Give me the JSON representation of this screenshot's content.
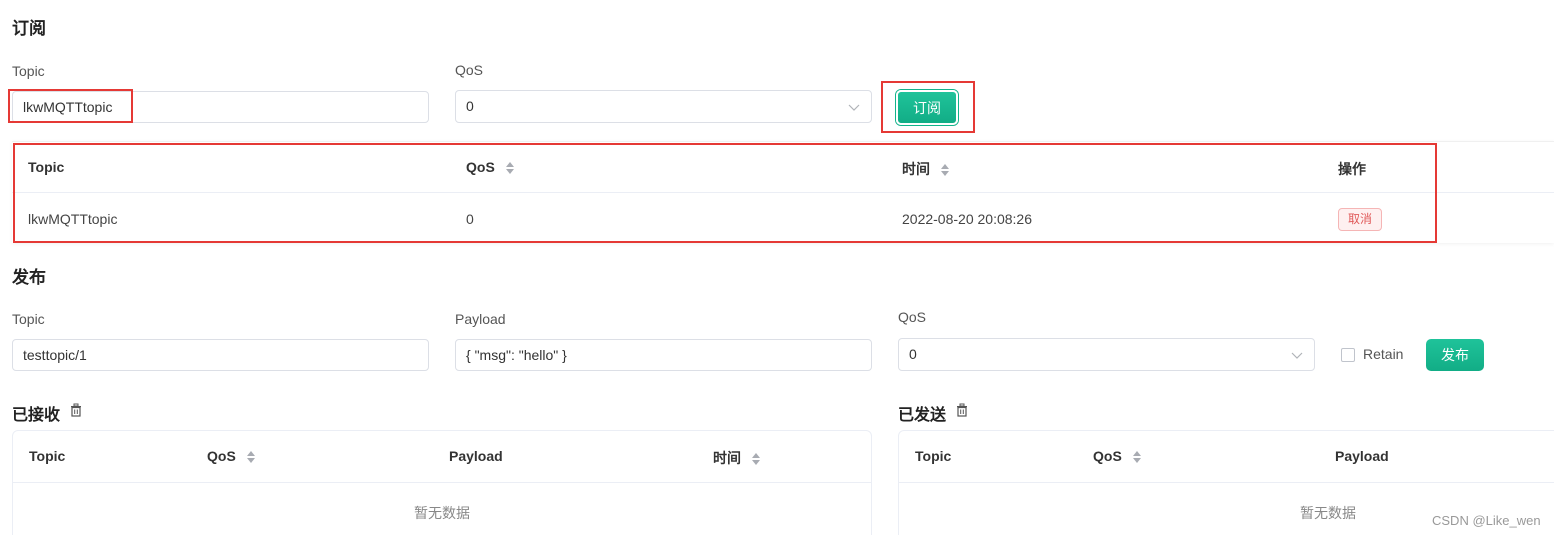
{
  "subscribe": {
    "title": "订阅",
    "topic_label": "Topic",
    "topic_value": "lkwMQTTtopic",
    "qos_label": "QoS",
    "qos_value": "0",
    "subscribe_button": "订阅",
    "table": {
      "headers": [
        "Topic",
        "QoS",
        "时间",
        "操作"
      ],
      "rows": [
        {
          "topic": "lkwMQTTtopic",
          "qos": "0",
          "time": "2022-08-20 20:08:26",
          "action": "取消"
        }
      ]
    }
  },
  "publish": {
    "title": "发布",
    "topic_label": "Topic",
    "topic_value": "testtopic/1",
    "payload_label": "Payload",
    "payload_value": "{ \"msg\": \"hello\" }",
    "qos_label": "QoS",
    "qos_value": "0",
    "retain_label": "Retain",
    "publish_button": "发布"
  },
  "received": {
    "title": "已接收",
    "headers": [
      "Topic",
      "QoS",
      "Payload",
      "时间"
    ],
    "empty_text": "暂无数据"
  },
  "sent": {
    "title": "已发送",
    "headers": [
      "Topic",
      "QoS",
      "Payload"
    ],
    "empty_text": "暂无数据"
  },
  "watermark": "CSDN @Like_wen",
  "colors": {
    "accent": "#13b38b",
    "highlight_box": "#e53935",
    "cancel_text": "#e05a5a"
  }
}
